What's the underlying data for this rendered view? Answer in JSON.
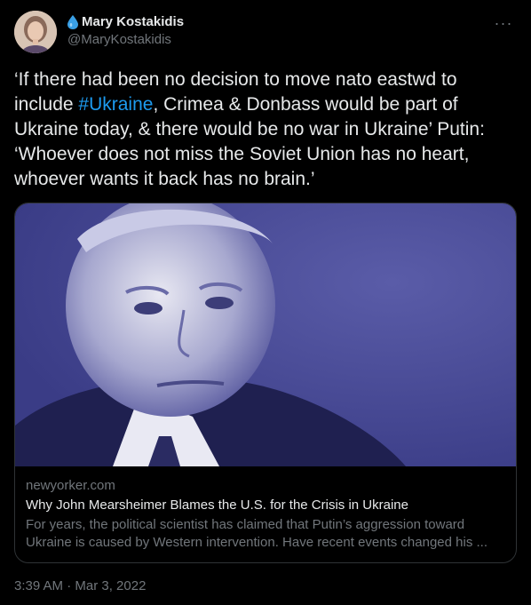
{
  "author": {
    "display_name": "Mary Kostakidis",
    "handle": "@MaryKostakidis",
    "name_emoji_icon": "droplet-icon",
    "avatar_icon": "profile-photo"
  },
  "more_icon": "more-horizontal-icon",
  "more_label": "···",
  "tweet": {
    "text_part1": "‘If there had been no decision to move nato eastwd to include ",
    "hashtag": "#Ukraine",
    "text_part2": ", Crimea & Donbass would be part of Ukraine today, & there would be no war in Ukraine’ Putin: ‘Whoever does not miss the Soviet Union has no heart, whoever wants it back has no brain.’"
  },
  "card": {
    "domain": "newyorker.com",
    "title": "Why John Mearsheimer Blames the U.S. for the Crisis in Ukraine",
    "description": "For years, the political scientist has claimed that Putin’s aggression toward Ukraine is caused by Western intervention. Have recent events changed his ..."
  },
  "timestamp": "3:39 AM · Mar 3, 2022",
  "colors": {
    "background": "#000000",
    "text": "#e7e9ea",
    "secondary": "#71767b",
    "accent": "#1d9bf0",
    "border": "#2f3336",
    "photo_tint": "#3d3f8f"
  }
}
